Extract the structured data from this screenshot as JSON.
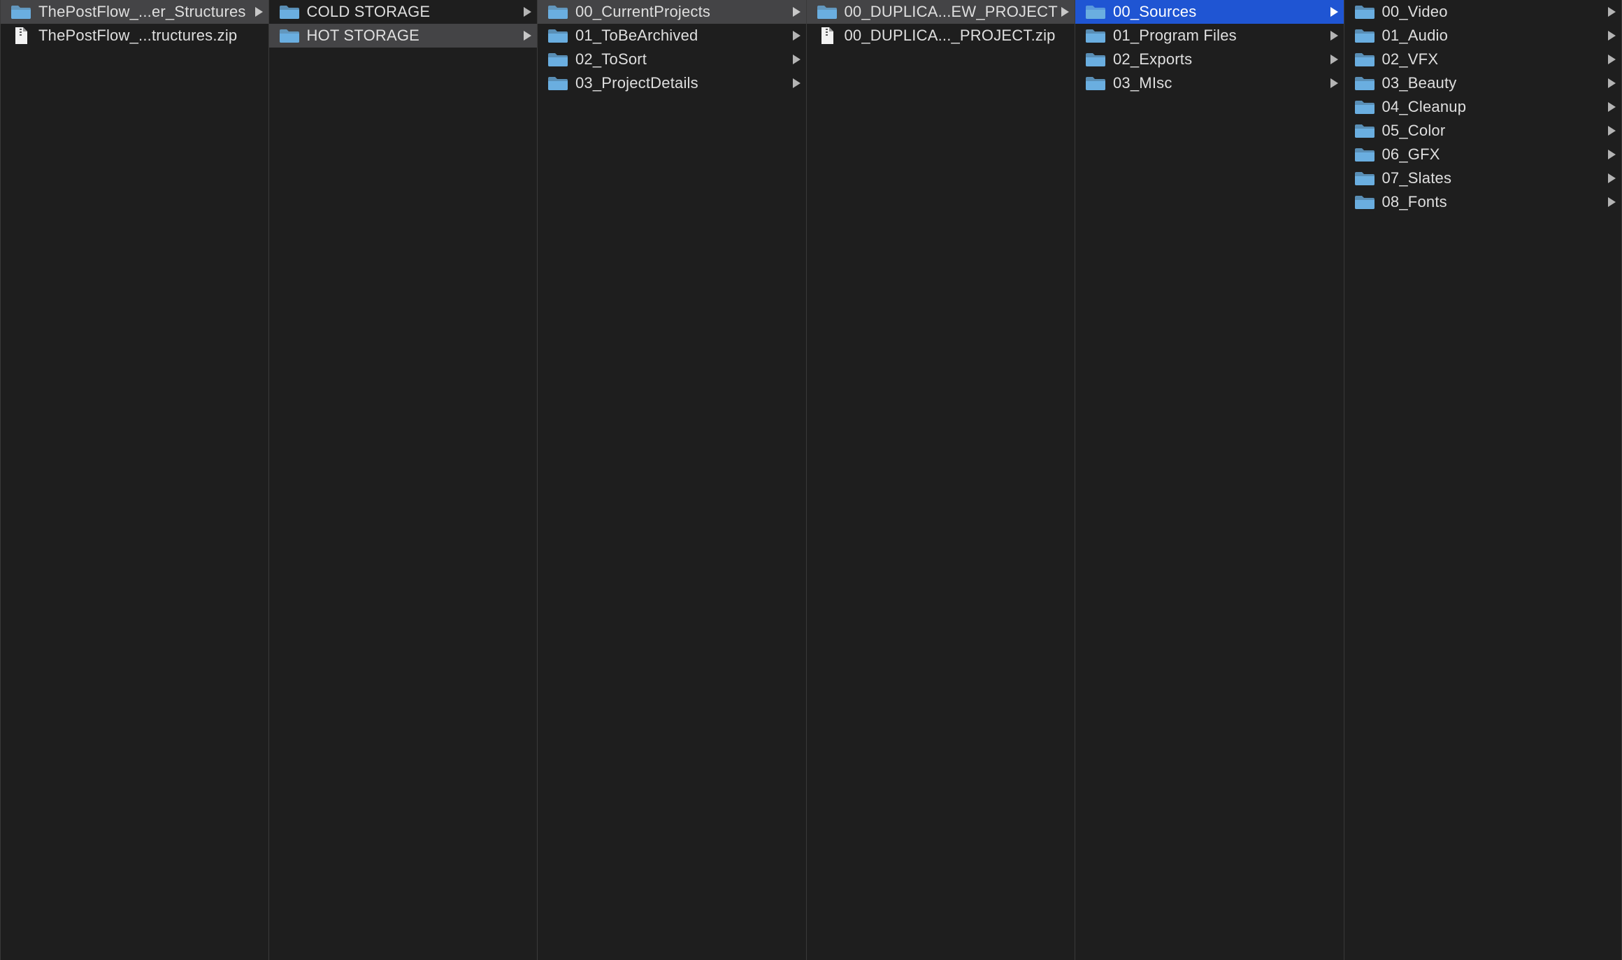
{
  "columns": [
    {
      "items": [
        {
          "label": "ThePostFlow_...er_Structures",
          "kind": "folder",
          "state": "path"
        },
        {
          "label": "ThePostFlow_...tructures.zip",
          "kind": "file",
          "state": "none"
        }
      ]
    },
    {
      "items": [
        {
          "label": "COLD STORAGE",
          "kind": "folder",
          "state": "none"
        },
        {
          "label": "HOT STORAGE",
          "kind": "folder",
          "state": "path"
        }
      ]
    },
    {
      "items": [
        {
          "label": "00_CurrentProjects",
          "kind": "folder",
          "state": "path"
        },
        {
          "label": "01_ToBeArchived",
          "kind": "folder",
          "state": "none"
        },
        {
          "label": "02_ToSort",
          "kind": "folder",
          "state": "none"
        },
        {
          "label": "03_ProjectDetails",
          "kind": "folder",
          "state": "none"
        }
      ]
    },
    {
      "items": [
        {
          "label": "00_DUPLICA...EW_PROJECT",
          "kind": "folder",
          "state": "path"
        },
        {
          "label": "00_DUPLICA..._PROJECT.zip",
          "kind": "file",
          "state": "none"
        }
      ]
    },
    {
      "items": [
        {
          "label": "00_Sources",
          "kind": "folder",
          "state": "active"
        },
        {
          "label": "01_Program Files",
          "kind": "folder",
          "state": "none"
        },
        {
          "label": "02_Exports",
          "kind": "folder",
          "state": "none"
        },
        {
          "label": "03_MIsc",
          "kind": "folder",
          "state": "none"
        }
      ]
    },
    {
      "items": [
        {
          "label": "00_Video",
          "kind": "folder",
          "state": "none"
        },
        {
          "label": "01_Audio",
          "kind": "folder",
          "state": "none"
        },
        {
          "label": "02_VFX",
          "kind": "folder",
          "state": "none"
        },
        {
          "label": "03_Beauty",
          "kind": "folder",
          "state": "none"
        },
        {
          "label": "04_Cleanup",
          "kind": "folder",
          "state": "none"
        },
        {
          "label": "05_Color",
          "kind": "folder",
          "state": "none"
        },
        {
          "label": "06_GFX",
          "kind": "folder",
          "state": "none"
        },
        {
          "label": "07_Slates",
          "kind": "folder",
          "state": "none"
        },
        {
          "label": "08_Fonts",
          "kind": "folder",
          "state": "none"
        }
      ]
    }
  ],
  "colors": {
    "background": "#1e1e1e",
    "path_highlight": "#444446",
    "selection": "#1f55d3",
    "folder_icon": "#6aaee0",
    "file_icon": "#f2f2f2",
    "text": "#dfdfdf"
  },
  "icons": {
    "folder": "folder-icon",
    "file": "document-icon",
    "disclosure": "disclosure-triangle-icon"
  }
}
